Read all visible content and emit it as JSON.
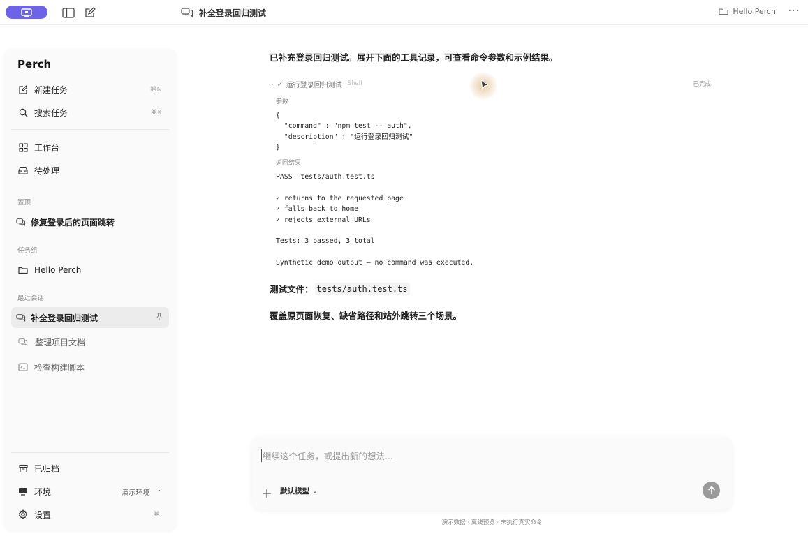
{
  "topbar": {
    "title": "补全登录回归测试",
    "workspace": "Hello Perch",
    "more": "···"
  },
  "sidebar": {
    "brand": "Perch",
    "new_task": {
      "label": "新建任务",
      "shortcut": "⌘N"
    },
    "search_task": {
      "label": "搜索任务",
      "shortcut": "⌘K"
    },
    "workbench": "工作台",
    "inbox": "待处理",
    "pinned_section": "置顶",
    "pinned_item": "修复登录后的页面跳转",
    "groups_section": "任务组",
    "group_item": "Hello Perch",
    "recent_section": "最近会话",
    "recent": [
      {
        "label": "补全登录回归测试"
      },
      {
        "label": "整理项目文档"
      },
      {
        "label": "检查构建脚本"
      }
    ],
    "archived": "已归档",
    "environment": {
      "label": "环境",
      "value": "演示环境"
    },
    "settings": {
      "label": "设置",
      "shortcut": "⌘,"
    }
  },
  "main": {
    "intro": "已补充登录回归测试。展开下面的工具记录，可查看命令参数和示例结果。",
    "tool": {
      "name": "运行登录回归测试",
      "kind": "Shell",
      "status": "已完成",
      "params_label": "参数",
      "params": "{\n  \"command\" : \"npm test -- auth\",\n  \"description\" : \"运行登录回归测试\"\n}",
      "result_label": "返回结果",
      "result": "PASS  tests/auth.test.ts\n\n✓ returns to the requested page\n✓ falls back to home\n✓ rejects external URLs\n\nTests: 3 passed, 3 total\n\nSynthetic demo output — no command was executed."
    },
    "test_file_label": "测试文件：",
    "test_file": "tests/auth.test.ts",
    "summary": "覆盖原页面恢复、缺省路径和站外跳转三个场景。"
  },
  "composer": {
    "placeholder": "继续这个任务，或提出新的想法...",
    "model": "默认模型"
  },
  "footer": "演示数据 · 离线预览 · 未执行真实命令",
  "colors": {
    "accent": "#6e62e6",
    "send": "#9b9b9b"
  }
}
